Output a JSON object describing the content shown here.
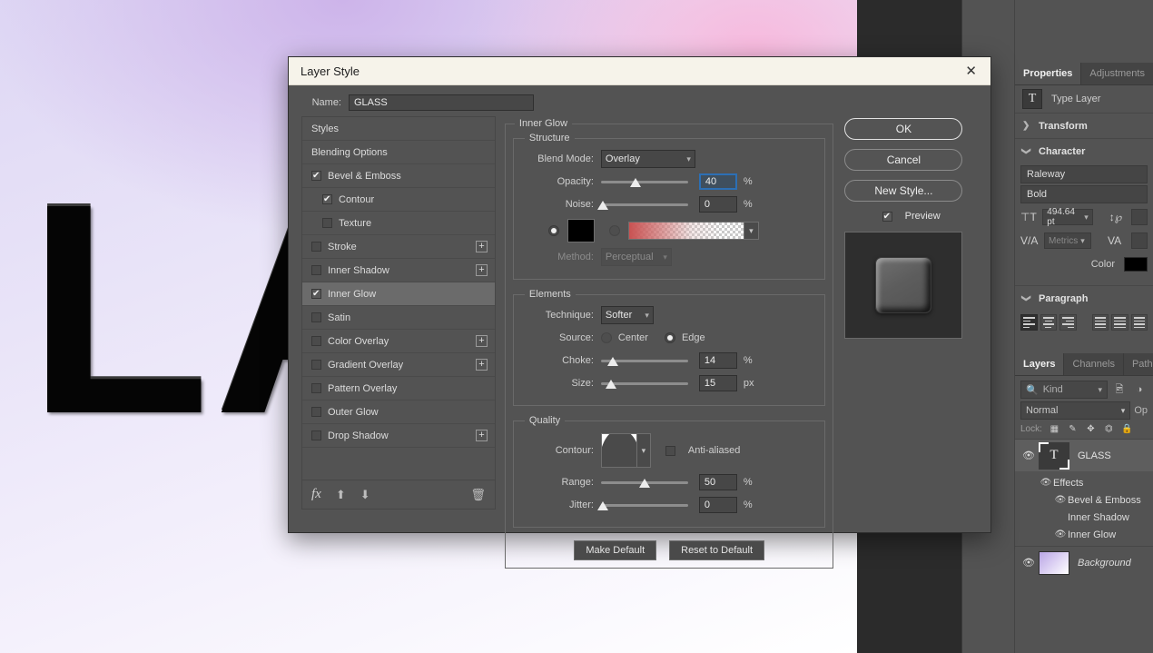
{
  "canvas": {
    "text": "LA"
  },
  "dialog": {
    "title": "Layer Style",
    "close_icon": "close-icon",
    "name_label": "Name:",
    "name_value": "GLASS",
    "styles_list": [
      {
        "label": "Styles",
        "checkbox": "none",
        "plus": false,
        "indent": 0,
        "selected": false
      },
      {
        "label": "Blending Options",
        "checkbox": "none",
        "plus": false,
        "indent": 0,
        "selected": false
      },
      {
        "label": "Bevel & Emboss",
        "checkbox": "on",
        "plus": false,
        "indent": 0,
        "selected": false
      },
      {
        "label": "Contour",
        "checkbox": "on",
        "plus": false,
        "indent": 1,
        "selected": false
      },
      {
        "label": "Texture",
        "checkbox": "off",
        "plus": false,
        "indent": 1,
        "selected": false
      },
      {
        "label": "Stroke",
        "checkbox": "off",
        "plus": true,
        "indent": 0,
        "selected": false
      },
      {
        "label": "Inner Shadow",
        "checkbox": "off",
        "plus": true,
        "indent": 0,
        "selected": false
      },
      {
        "label": "Inner Glow",
        "checkbox": "on",
        "plus": false,
        "indent": 0,
        "selected": true
      },
      {
        "label": "Satin",
        "checkbox": "off",
        "plus": false,
        "indent": 0,
        "selected": false
      },
      {
        "label": "Color Overlay",
        "checkbox": "off",
        "plus": true,
        "indent": 0,
        "selected": false
      },
      {
        "label": "Gradient Overlay",
        "checkbox": "off",
        "plus": true,
        "indent": 0,
        "selected": false
      },
      {
        "label": "Pattern Overlay",
        "checkbox": "off",
        "plus": false,
        "indent": 0,
        "selected": false
      },
      {
        "label": "Outer Glow",
        "checkbox": "off",
        "plus": false,
        "indent": 0,
        "selected": false
      },
      {
        "label": "Drop Shadow",
        "checkbox": "off",
        "plus": true,
        "indent": 0,
        "selected": false
      }
    ],
    "toolbar": {
      "fx_icon": "fx-icon",
      "up_icon": "arrow-up-icon",
      "down_icon": "arrow-down-icon",
      "trash_icon": "trash-icon"
    },
    "panel": {
      "title": "Inner Glow",
      "structure": {
        "legend": "Structure",
        "blend_mode_label": "Blend Mode:",
        "blend_mode_value": "Overlay",
        "opacity_label": "Opacity:",
        "opacity_value": "40",
        "opacity_unit": "%",
        "noise_label": "Noise:",
        "noise_value": "0",
        "noise_unit": "%",
        "fill_type": "color",
        "color_value": "#000000",
        "gradient_from": "#c95252",
        "method_label": "Method:",
        "method_value": "Perceptual",
        "method_disabled": true
      },
      "elements": {
        "legend": "Elements",
        "technique_label": "Technique:",
        "technique_value": "Softer",
        "source_label": "Source:",
        "source_center": "Center",
        "source_edge": "Edge",
        "source_selected": "Edge",
        "choke_label": "Choke:",
        "choke_value": "14",
        "choke_unit": "%",
        "size_label": "Size:",
        "size_value": "15",
        "size_unit": "px"
      },
      "quality": {
        "legend": "Quality",
        "contour_label": "Contour:",
        "anti_aliased_label": "Anti-aliased",
        "anti_aliased_checked": false,
        "range_label": "Range:",
        "range_value": "50",
        "range_unit": "%",
        "jitter_label": "Jitter:",
        "jitter_value": "0",
        "jitter_unit": "%"
      },
      "make_default": "Make Default",
      "reset_to_default": "Reset to Default"
    },
    "buttons": {
      "ok": "OK",
      "cancel": "Cancel",
      "new_style": "New Style...",
      "preview_label": "Preview",
      "preview_checked": true
    }
  },
  "properties_panel": {
    "tabs": [
      {
        "label": "Properties",
        "active": true
      },
      {
        "label": "Adjustments",
        "active": false
      }
    ],
    "layer_kind": "Type Layer",
    "type_icon": "T",
    "transform_label": "Transform",
    "character_label": "Character",
    "font_family": "Raleway",
    "font_style": "Bold",
    "font_size": "494.64 pt",
    "kerning": "Metrics",
    "leading": "",
    "tracking": "",
    "color_label": "Color",
    "color_value": "#000000",
    "paragraph_label": "Paragraph"
  },
  "layers_panel": {
    "tabs": [
      {
        "label": "Layers",
        "active": true
      },
      {
        "label": "Channels",
        "active": false
      },
      {
        "label": "Paths",
        "active": false
      }
    ],
    "filter_placeholder": "Kind",
    "blend_mode": "Normal",
    "opacity_label": "Op",
    "lock_label": "Lock:",
    "lock_icons": [
      "transparency-icon",
      "brush-icon",
      "move-icon",
      "artboard-icon",
      "lock-icon"
    ],
    "layers": [
      {
        "name": "GLASS",
        "kind": "type",
        "visible": true,
        "selected": true,
        "effects_label": "Effects",
        "effects": [
          {
            "name": "Bevel & Emboss",
            "visible": true
          },
          {
            "name": "Inner Shadow",
            "visible": false
          },
          {
            "name": "Inner Glow",
            "visible": true
          }
        ]
      },
      {
        "name": "Background",
        "kind": "image",
        "visible": true,
        "selected": false,
        "italic": true
      }
    ]
  }
}
